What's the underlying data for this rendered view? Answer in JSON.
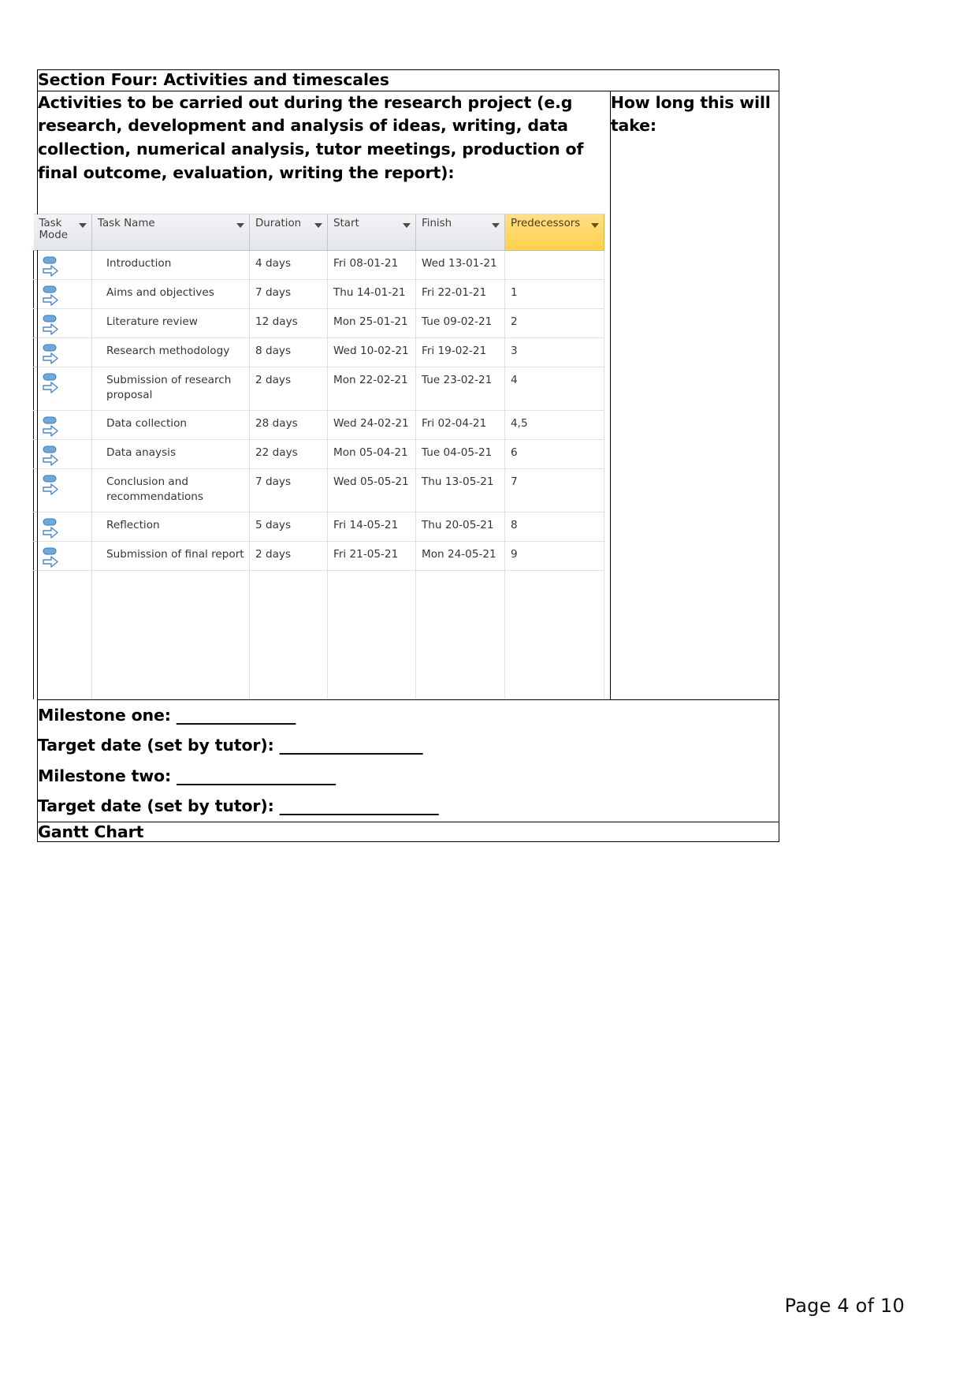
{
  "document": {
    "section_title": "Section Four: Activities and timescales",
    "activities_heading": "Activities to be carried out during the research project (e.g research, development and analysis of ideas, writing, data collection, numerical analysis, tutor meetings, production of final outcome, evaluation, writing the report):",
    "howlong_heading": "How long this will take:"
  },
  "project_table": {
    "columns": [
      {
        "key": "mode",
        "label": "Task Mode",
        "highlighted": false
      },
      {
        "key": "name",
        "label": "Task Name",
        "highlighted": false
      },
      {
        "key": "duration",
        "label": "Duration",
        "highlighted": false
      },
      {
        "key": "start",
        "label": "Start",
        "highlighted": false
      },
      {
        "key": "finish",
        "label": "Finish",
        "highlighted": false
      },
      {
        "key": "predecessors",
        "label": "Predecessors",
        "highlighted": true
      }
    ],
    "highlight_color": "#ffd04a",
    "header_color": "#e3e6e9",
    "rows": [
      {
        "mode_icon": "manual-task-mode-icon",
        "name": "Introduction",
        "duration": "4 days",
        "start": "Fri 08-01-21",
        "finish": "Wed 13-01-21",
        "predecessors": ""
      },
      {
        "mode_icon": "manual-task-mode-icon",
        "name": "Aims and objectives",
        "duration": "7 days",
        "start": "Thu 14-01-21",
        "finish": "Fri 22-01-21",
        "predecessors": "1"
      },
      {
        "mode_icon": "manual-task-mode-icon",
        "name": "Literature review",
        "duration": "12 days",
        "start": "Mon 25-01-21",
        "finish": "Tue 09-02-21",
        "predecessors": "2"
      },
      {
        "mode_icon": "manual-task-mode-icon",
        "name": "Research methodology",
        "duration": "8 days",
        "start": "Wed 10-02-21",
        "finish": "Fri 19-02-21",
        "predecessors": "3"
      },
      {
        "mode_icon": "manual-task-mode-icon",
        "name": "Submission of research proposal",
        "duration": "2 days",
        "start": "Mon 22-02-21",
        "finish": "Tue 23-02-21",
        "predecessors": "4"
      },
      {
        "mode_icon": "manual-task-mode-icon",
        "name": "Data collection",
        "duration": "28 days",
        "start": "Wed 24-02-21",
        "finish": "Fri 02-04-21",
        "predecessors": "4,5"
      },
      {
        "mode_icon": "manual-task-mode-icon",
        "name": "Data anaysis",
        "duration": "22 days",
        "start": "Mon 05-04-21",
        "finish": "Tue 04-05-21",
        "predecessors": "6"
      },
      {
        "mode_icon": "manual-task-mode-icon",
        "name": "Conclusion and recommendations",
        "duration": "7 days",
        "start": "Wed 05-05-21",
        "finish": "Thu 13-05-21",
        "predecessors": "7"
      },
      {
        "mode_icon": "manual-task-mode-icon",
        "name": "Reflection",
        "duration": "5 days",
        "start": "Fri 14-05-21",
        "finish": "Thu 20-05-21",
        "predecessors": "8"
      },
      {
        "mode_icon": "manual-task-mode-icon",
        "name": "Submission of final report",
        "duration": "2 days",
        "start": "Fri 21-05-21",
        "finish": "Mon 24-05-21",
        "predecessors": "9"
      }
    ]
  },
  "milestones": {
    "line1": "Milestone one:  _______________",
    "line2": "Target date (set by tutor): __________________",
    "line3": "Milestone two: ____________________",
    "line4": "Target date (set by tutor): ____________________",
    "gantt_title": "Gantt Chart"
  },
  "footer": {
    "page_label": "Page 4 of 10"
  }
}
